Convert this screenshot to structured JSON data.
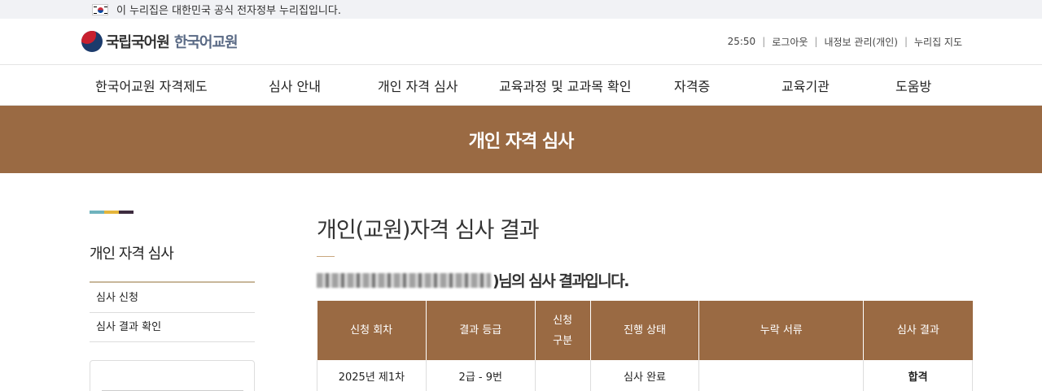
{
  "gov_bar": {
    "text": "이 누리집은 대한민국 공식 전자정부 누리집입니다."
  },
  "header": {
    "org_name": "국립국어원",
    "site_name": "한국어교원",
    "util": {
      "timer": "25:50",
      "logout": "로그아웃",
      "my_info": "내정보 관리(개인)",
      "sitemap": "누리집 지도"
    }
  },
  "gnb": {
    "items": [
      "한국어교원 자격제도",
      "심사 안내",
      "개인 자격 심사",
      "교육과정 및 교과목 확인",
      "자격증",
      "교육기관",
      "도움방"
    ]
  },
  "hero": {
    "title": "개인 자격 심사"
  },
  "lnb": {
    "title": "개인 자격 심사",
    "items": [
      "심사 신청",
      "심사 결과 확인"
    ],
    "bar_colors": [
      "#6fb3bd",
      "#e5b53a",
      "#3d2c3e"
    ]
  },
  "main": {
    "title": "개인(교원)자격 심사 결과",
    "result_suffix": ")님의 심사 결과입니다.",
    "table": {
      "headers": [
        "신청 회차",
        "결과 등급",
        "신청\n구분",
        "진행 상태",
        "누락 서류",
        "심사 결과"
      ],
      "header_apply_type_line1": "신청",
      "header_apply_type_line2": "구분",
      "rows": [
        {
          "round": "2025년 제1차",
          "grade": "2급 - 9번",
          "type": "",
          "status": "심사 완료",
          "missing": "",
          "result": "합격"
        }
      ]
    }
  },
  "colors": {
    "brand_brown": "#9a6a43",
    "gov_bar_bg": "#f1f2f5"
  }
}
